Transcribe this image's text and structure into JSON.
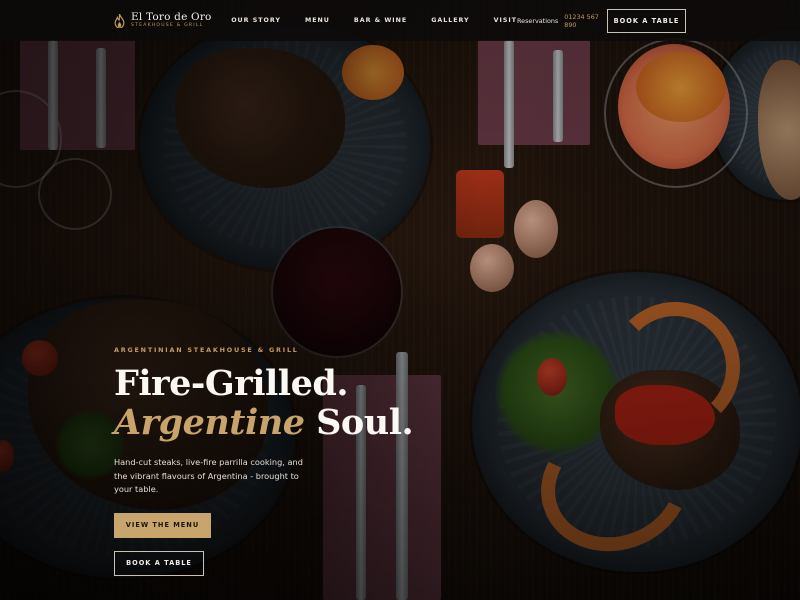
{
  "brand": {
    "name": "El Toro de Oro",
    "tagline": "STEAKHOUSE & GRILL",
    "icon": "flame-icon"
  },
  "nav": {
    "links": [
      "OUR STORY",
      "MENU",
      "BAR & WINE",
      "GALLERY",
      "VISIT"
    ],
    "reservations_label": "Reservations",
    "reservations_phone": "01234 567 890",
    "book_label": "BOOK A TABLE"
  },
  "hero": {
    "eyebrow": "ARGENTINIAN STEAKHOUSE & GRILL",
    "headline_line1": "Fire-Grilled.",
    "headline_accent": "Argentine",
    "headline_line2_rest": "Soul.",
    "subtext": "Hand-cut steaks, live-fire parrilla cooking, and the vibrant flavours of Argentina - brought to your table.",
    "primary_cta": "VIEW THE MENU",
    "secondary_cta": "BOOK A TABLE"
  },
  "colors": {
    "accent_gold": "#c7a56d",
    "nav_bg": "#0c0a0a",
    "text_light": "#fbf8f3"
  }
}
